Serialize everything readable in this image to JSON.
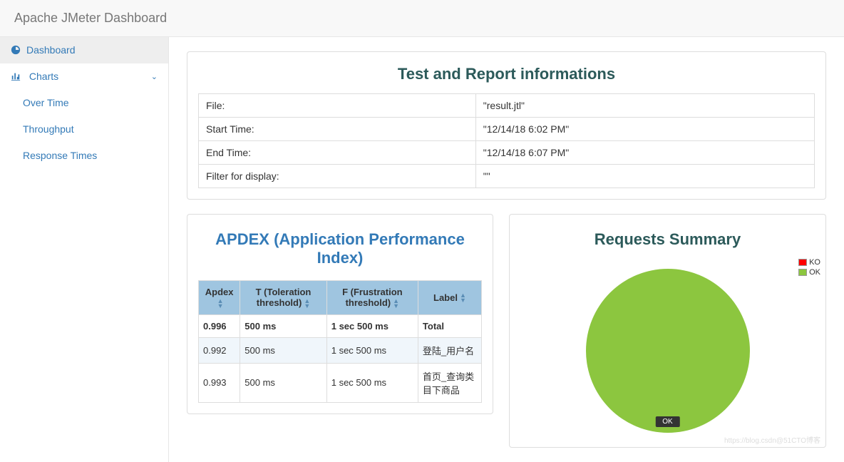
{
  "navbar": {
    "title": "Apache JMeter Dashboard"
  },
  "sidebar": {
    "dashboard": {
      "label": "Dashboard"
    },
    "charts": {
      "label": "Charts",
      "children": {
        "over_time": "Over Time",
        "throughput": "Throughput",
        "response_times": "Response Times"
      }
    }
  },
  "info_panel": {
    "title": "Test and Report informations",
    "rows": {
      "file_label": "File:",
      "file_value": "\"result.jtl\"",
      "start_label": "Start Time:",
      "start_value": "\"12/14/18 6:02 PM\"",
      "end_label": "End Time:",
      "end_value": "\"12/14/18 6:07 PM\"",
      "filter_label": "Filter for display:",
      "filter_value": "\"\""
    }
  },
  "apdex": {
    "title": "APDEX (Application Performance Index)",
    "headers": {
      "apdex": "Apdex",
      "toleration": "T (Toleration threshold)",
      "frustration": "F (Frustration threshold)",
      "label": "Label"
    },
    "rows": [
      {
        "apdex": "0.996",
        "t": "500 ms",
        "f": "1 sec 500 ms",
        "label": "Total"
      },
      {
        "apdex": "0.992",
        "t": "500 ms",
        "f": "1 sec 500 ms",
        "label": "登陆_用户名"
      },
      {
        "apdex": "0.993",
        "t": "500 ms",
        "f": "1 sec 500 ms",
        "label": "首页_查询类目下商品"
      }
    ]
  },
  "summary": {
    "title": "Requests Summary",
    "legend": {
      "ko": "KO",
      "ok": "OK"
    },
    "colors": {
      "ko": "#ff0000",
      "ok": "#8cc63f"
    },
    "pie_label": "OK"
  },
  "chart_data": {
    "type": "pie",
    "title": "Requests Summary",
    "series": [
      {
        "name": "OK",
        "value": 100,
        "color": "#8cc63f"
      },
      {
        "name": "KO",
        "value": 0,
        "color": "#ff0000"
      }
    ]
  },
  "watermark": "https://blog.csdn@51CTO博客"
}
